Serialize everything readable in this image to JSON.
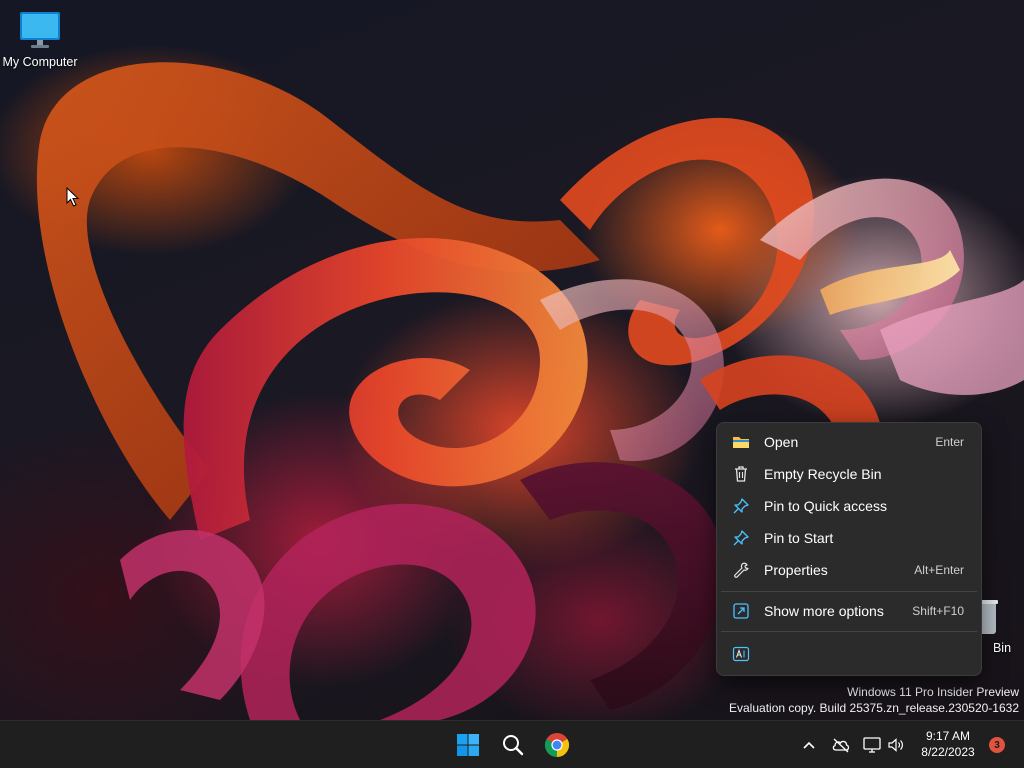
{
  "desktop": {
    "icons": [
      {
        "label": "My Computer",
        "icon": "monitor-icon"
      },
      {
        "label": "Bin",
        "icon": "recycle-bin-icon"
      }
    ],
    "watermark": {
      "line1": "Windows 11 Pro Insider Preview",
      "line2": "Evaluation copy. Build 25375.zn_release.230520-1632"
    }
  },
  "context_menu": {
    "items": [
      {
        "label": "Open",
        "shortcut": "Enter",
        "icon": "folder-icon"
      },
      {
        "label": "Empty Recycle Bin",
        "shortcut": "",
        "icon": "trash-icon"
      },
      {
        "label": "Pin to Quick access",
        "shortcut": "",
        "icon": "pin-icon"
      },
      {
        "label": "Pin to Start",
        "shortcut": "",
        "icon": "pin-icon"
      },
      {
        "label": "Properties",
        "shortcut": "Alt+Enter",
        "icon": "wrench-icon"
      },
      {
        "label": "Show more options",
        "shortcut": "Shift+F10",
        "icon": "more-options-icon"
      }
    ],
    "bottom_icon": "translate-icon"
  },
  "taskbar": {
    "apps": [
      "windows-start-icon",
      "search-icon",
      "chrome-icon"
    ],
    "tray": [
      "chevron-up-icon",
      "cloud-offline-icon",
      "network-icon",
      "volume-icon"
    ],
    "time": "9:17 AM",
    "date": "8/22/2023",
    "notification_count": "3"
  },
  "colors": {
    "accent_blue": "#4cc2ff",
    "windows_blue": "#1aa1f2",
    "badge": "#e0533f",
    "menu_bg": "#2b2b2b",
    "taskbar_bg": "#1f1f1f"
  }
}
